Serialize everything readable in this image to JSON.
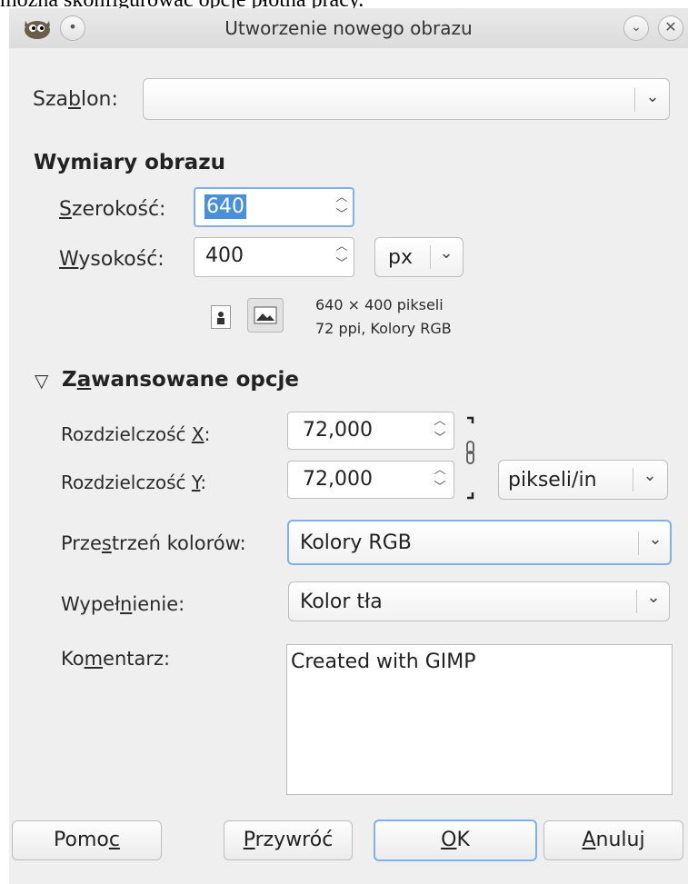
{
  "caption": "można skonfigurować opcje płótna pracy.",
  "window": {
    "title": "Utworzenie nowego obrazu"
  },
  "template": {
    "label_pre": "Sza",
    "label_u": "b",
    "label_post": "lon:",
    "value": ""
  },
  "image_size": {
    "heading": "Wymiary obrazu",
    "width": {
      "label_u": "S",
      "label_rest": "zerokość:",
      "value": "640"
    },
    "height": {
      "label_u": "W",
      "label_rest": "ysokość:",
      "value": "400"
    },
    "unit": "px",
    "info_line1": "640 × 400 pikseli",
    "info_line2": "72 ppi, Kolory RGB"
  },
  "advanced": {
    "heading_pre": "Z",
    "heading_u": "a",
    "heading_post": "wansowane opcje",
    "res_x": {
      "label_pre": "Rozdzielczość ",
      "label_u": "X",
      "label_post": ":",
      "value": "72,000"
    },
    "res_y": {
      "label_pre": "Rozdzielczość ",
      "label_u": "Y",
      "label_post": ":",
      "value": "72,000"
    },
    "res_unit": "pikseli/in",
    "colorspace": {
      "label_pre": "Prze",
      "label_u": "s",
      "label_post": "trzeń kolorów:",
      "value": "Kolory RGB"
    },
    "fill": {
      "label_pre": "Wypeł",
      "label_u": "n",
      "label_post": "ienie:",
      "value": "Kolor tła"
    },
    "comment": {
      "label_pre": "Ko",
      "label_u": "m",
      "label_post": "entarz:",
      "value": "Created with GIMP"
    }
  },
  "buttons": {
    "help": {
      "pre": "Pomo",
      "u": "c",
      "post": ""
    },
    "reset": {
      "pre": "",
      "u": "P",
      "post": "rzywróć"
    },
    "ok": {
      "pre": "",
      "u": "O",
      "post": "K"
    },
    "cancel": {
      "pre": "",
      "u": "A",
      "post": "nuluj"
    }
  },
  "icons": {
    "app": "gimp-wilber-icon",
    "pin": "pin-icon",
    "minimize": "minimize-icon",
    "close": "close-icon",
    "portrait": "portrait-orientation-icon",
    "landscape": "landscape-orientation-icon",
    "chain": "chain-link-icon",
    "expander": "expander-triangle-icon"
  },
  "colors": {
    "focus": "#7fb1e6",
    "selection": "#4a90d9"
  }
}
